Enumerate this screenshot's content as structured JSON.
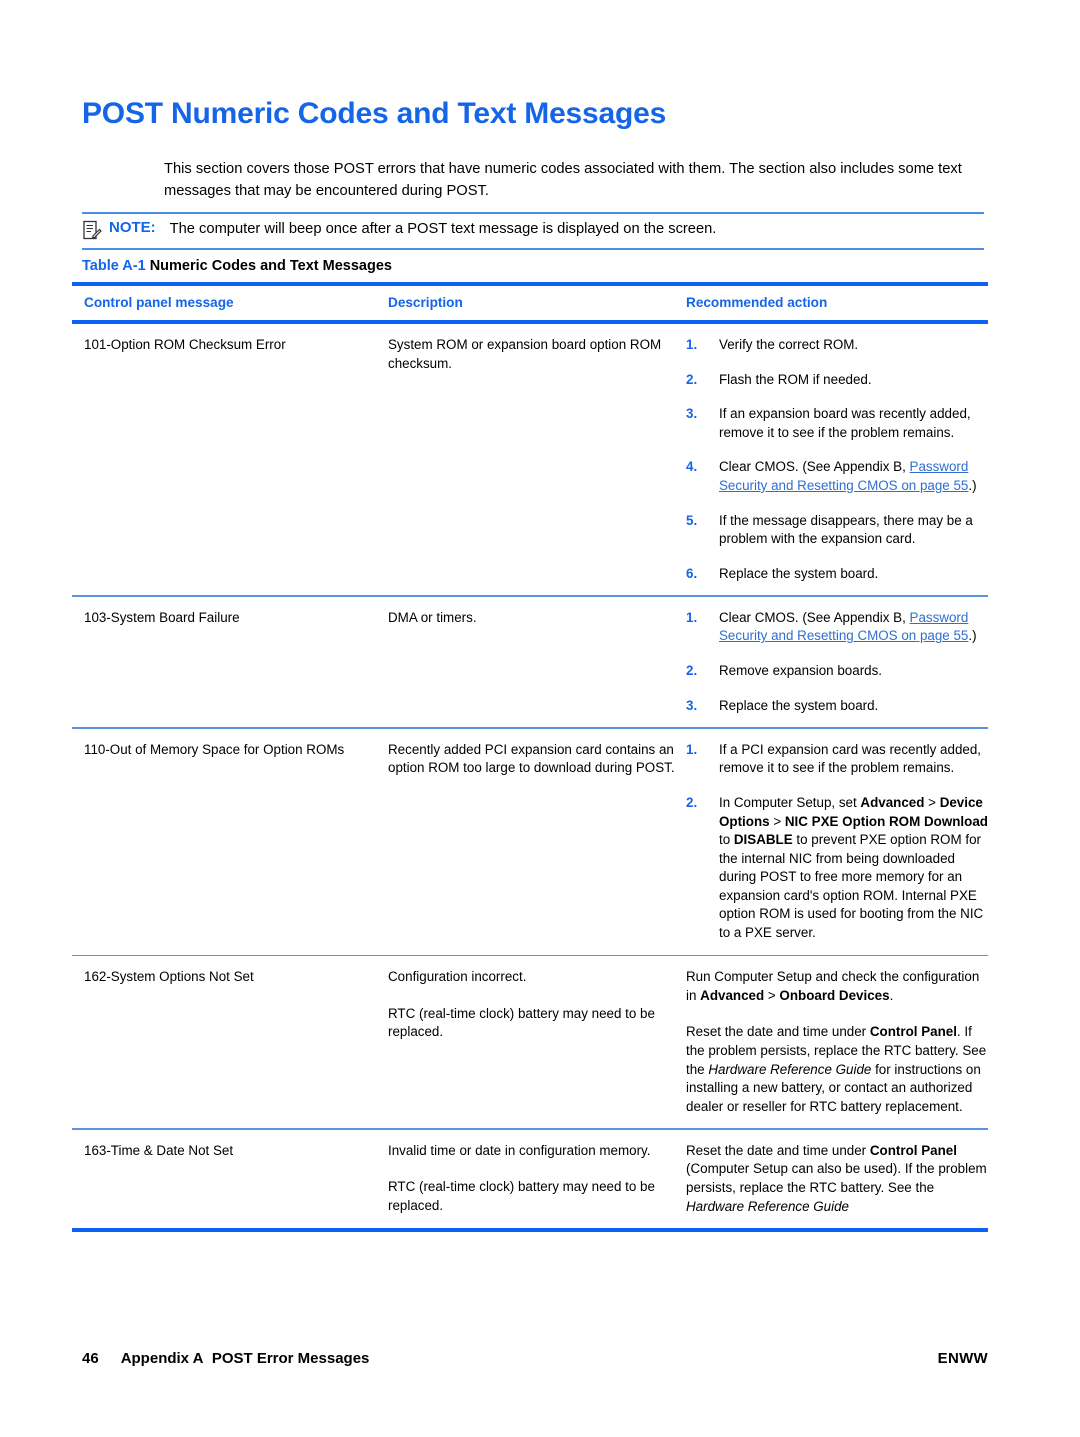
{
  "heading": "POST Numeric Codes and Text Messages",
  "intro": "This section covers those POST errors that have numeric codes associated with them. The section also includes some text messages that may be encountered during POST.",
  "note": {
    "icon": "note-pad-pencil-icon",
    "label": "NOTE:",
    "text": "The computer will beep once after a POST text message is displayed on the screen."
  },
  "table": {
    "caption_label": "Table A-1",
    "caption_title": "Numeric Codes and Text Messages",
    "headers": {
      "col1": "Control panel message",
      "col2": "Description",
      "col3": "Recommended action"
    },
    "rows": [
      {
        "message": "101-Option ROM Checksum Error",
        "description": [
          "System ROM or expansion board option ROM checksum."
        ],
        "actions": [
          "Verify the correct ROM.",
          "Flash the ROM if needed.",
          "If an expansion board was recently added, remove it to see if the problem remains.",
          "Clear CMOS. (See Appendix B, Password Security and Resetting CMOS on page 55.)",
          "If the message disappears, there may be a problem with the expansion card.",
          "Replace the system board."
        ],
        "link_text": "Password Security and Resetting CMOS on page 55"
      },
      {
        "message": "103-System Board Failure",
        "description": [
          "DMA or timers."
        ],
        "actions": [
          "Clear CMOS. (See Appendix B, Password Security and Resetting CMOS on page 55.)",
          "Remove expansion boards.",
          "Replace the system board."
        ],
        "link_text": "Password Security and Resetting CMOS on page 55"
      },
      {
        "message": "110-Out of Memory Space for Option ROMs",
        "description": [
          "Recently added PCI expansion card contains an option ROM too large to download during POST."
        ],
        "actions": [
          "If a PCI expansion card was recently added, remove it to see if the problem remains.",
          "In Computer Setup, set Advanced > Device Options > NIC PXE Option ROM Download to DISABLE to prevent PXE option ROM for the internal NIC from being downloaded during POST to free more memory for an expansion card's option ROM. Internal PXE option ROM is used for booting from the NIC to a PXE server."
        ]
      },
      {
        "message": "162-System Options Not Set",
        "description": [
          "Configuration incorrect.",
          "RTC (real-time clock) battery may need to be replaced."
        ],
        "actions_plain": [
          "Run Computer Setup and check the configuration in Advanced > Onboard Devices.",
          "Reset the date and time under Control Panel. If the problem persists, replace the RTC battery. See the Hardware Reference Guide for instructions on installing a new battery, or contact an authorized dealer or reseller for RTC battery replacement."
        ]
      },
      {
        "message": "163-Time & Date Not Set",
        "description": [
          "Invalid time or date in configuration memory.",
          "RTC (real-time clock) battery may need to be replaced."
        ],
        "actions_plain": [
          "Reset the date and time under Control Panel (Computer Setup can also be used). If the problem persists, replace the RTC battery. See the Hardware Reference Guide"
        ]
      }
    ]
  },
  "footer": {
    "page_number": "46",
    "appendix": "Appendix A",
    "section": "POST Error Messages",
    "right": "ENWW"
  },
  "colors": {
    "heading_blue": "#1565E8",
    "rule_blue": "#0B62F4",
    "thin_rule_blue": "#5C93DE",
    "link_blue": "#2F6FD0"
  }
}
